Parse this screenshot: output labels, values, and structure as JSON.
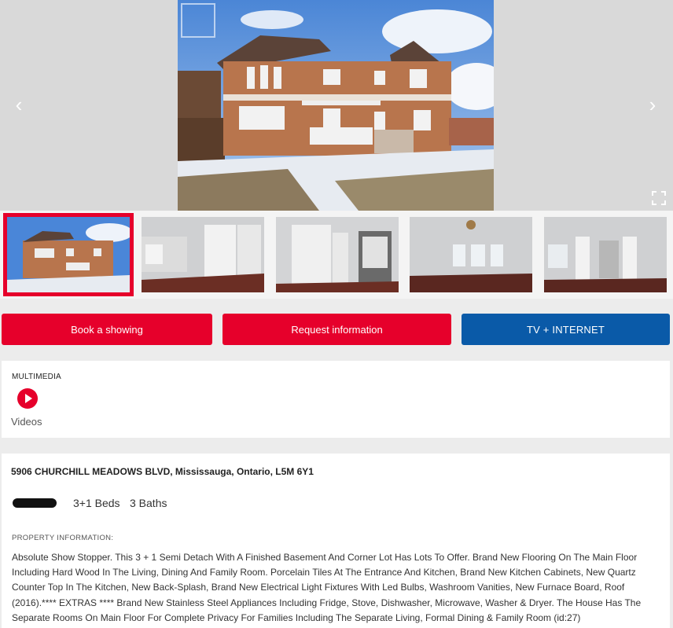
{
  "gallery": {
    "prev_icon": "chevron-left-icon",
    "next_icon": "chevron-right-icon",
    "prev_glyph": "‹",
    "next_glyph": "›",
    "expand_icon": "fullscreen-icon",
    "thumbnails": [
      "house-exterior",
      "foyer-entrance",
      "entrance-door",
      "living-room",
      "dining-room"
    ],
    "active_thumbnail": 0
  },
  "actions": {
    "book": "Book a showing",
    "request": "Request information",
    "tv": "TV + INTERNET"
  },
  "multimedia": {
    "label": "MULTIMEDIA",
    "videos": "Videos"
  },
  "property": {
    "address": "5906 CHURCHILL MEADOWS BLVD, Mississauga, Ontario, L5M 6Y1",
    "beds": "3+1 Beds",
    "baths": "3 Baths",
    "info_label": "PROPERTY INFORMATION:",
    "description": "Absolute Show Stopper. This 3 + 1 Semi Detach With A Finished Basement And Corner Lot Has Lots To Offer. Brand New Flooring On The Main Floor Including Hard Wood In The Living, Dining And Family Room. Porcelain Tiles At The Entrance And Kitchen, Brand New Kitchen Cabinets, New Quartz Counter Top In The Kitchen, New Back-Splash, Brand New Electrical Light Fixtures With Led Bulbs, Washroom Vanities, New Furnace Board, Roof (2016).**** EXTRAS **** Brand New Stainless Steel Appliances Including Fridge, Stove, Dishwasher, Microwave, Washer & Dryer. The House Has The Separate Rooms On Main Floor For Complete Privacy For Families Including The Separate Living, Formal Dining & Family Room (id:27)"
  },
  "colors": {
    "brand_red": "#e6002b",
    "tv_blue": "#0a5aa8"
  }
}
